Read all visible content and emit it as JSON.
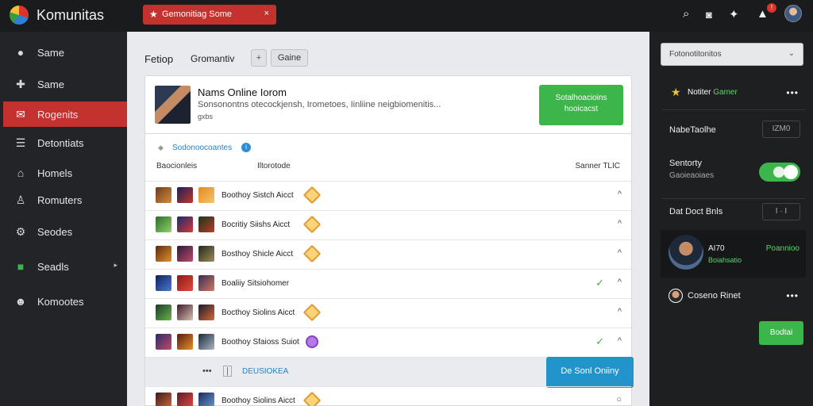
{
  "app": {
    "title": "Komunitas"
  },
  "alert": {
    "text": "Gemonitiag Some",
    "close": "×"
  },
  "sidebar": {
    "items": [
      {
        "label": "Same",
        "icon": "chat-icon"
      },
      {
        "label": "Same",
        "icon": "gamepad-icon"
      },
      {
        "label": "Rogenits",
        "icon": "envelope-icon",
        "active": true
      },
      {
        "label": "Detontiats",
        "icon": "list-icon"
      },
      {
        "label": "Homels",
        "icon": "home-icon"
      },
      {
        "label": "Romuters",
        "icon": "user-icon"
      },
      {
        "label": "Seodes",
        "icon": "gear-icon"
      },
      {
        "label": "Seadls",
        "icon": "folder-icon",
        "arrow": "▸"
      },
      {
        "label": "Komootes",
        "icon": "group-icon"
      }
    ]
  },
  "main": {
    "breadcrumb": {
      "first": "Fetiop",
      "second": "Gromantiv",
      "btn_icon": "+",
      "btn_label": "Gaine"
    },
    "header": {
      "title": "Nams Online Iorom",
      "subtitle": "Sonsonontns otecockjensh, Irometoes, Iinliine neigbiomenitis...",
      "avatar_tag": "gxbs",
      "action_line1": "Sotalhoacioins",
      "action_line2": "hooicacst"
    },
    "list": {
      "title": "Sodonoocoantes",
      "info": "i",
      "filter1": "Baocionleis",
      "filter2": "Iltorotode",
      "filter3": "Sanner TLIC",
      "rows": [
        {
          "label": "Boothoy Sistch Aicct",
          "gem": "orange",
          "check": false,
          "caret": "^"
        },
        {
          "label": "Bocritiy Siishs Aicct",
          "gem": "orange",
          "check": false,
          "caret": "^"
        },
        {
          "label": "Bosthoy Shicle Aicct",
          "gem": "orange",
          "check": false,
          "caret": "^"
        },
        {
          "label": "Boaliiy Sitsiohomer",
          "gem": "none",
          "check": true,
          "caret": "^"
        },
        {
          "label": "Bocthoy Siolins Aicct",
          "gem": "orange",
          "check": false,
          "caret": "^"
        },
        {
          "label": "Boothoy Sfaioss Suiot",
          "gem": "purple",
          "check": true,
          "caret": "^"
        }
      ],
      "footer_row": {
        "dots": "•••",
        "pipe": "|",
        "label": "DEUSIOKEA",
        "button": "De Sonl Oniiny"
      },
      "last_row": {
        "label": "Boothoy Siolins Aicct",
        "gem": "orange",
        "caret": "○"
      }
    }
  },
  "rpanel": {
    "select": {
      "label": "Fotonotitonitos",
      "chev": "⌄"
    },
    "section_title": "Notiter",
    "section_title_accent": "Gamer",
    "more": "•••",
    "field1": {
      "label": "NabeTaolhe",
      "value": "IZM0"
    },
    "field2": {
      "label": "Sentorty",
      "sub": "Gaoieaoiaes"
    },
    "field3": {
      "label": "Dat Doct Bnls",
      "value": "I · I"
    },
    "user": {
      "name": "AI70",
      "sub": "Boiahsatio",
      "status": "Poannioo"
    },
    "row2": {
      "label": "Coseno Rinet",
      "more": "•••"
    },
    "button": "Bodtai"
  },
  "colors": {
    "accent_red": "#c3322e",
    "accent_green": "#3cb54a",
    "accent_blue": "#2294cc"
  }
}
